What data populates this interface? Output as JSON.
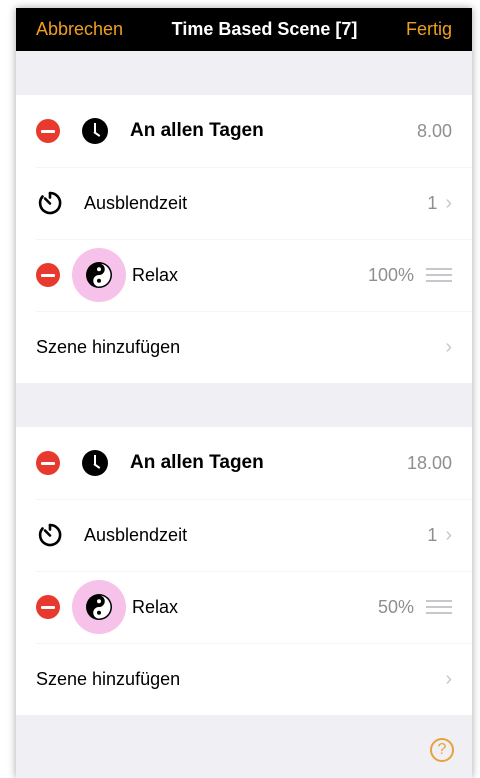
{
  "navbar": {
    "cancel_label": "Abbrechen",
    "title": "Time Based Scene [7]",
    "done_label": "Fertig"
  },
  "schedules": [
    {
      "time_title": "An allen Tagen",
      "time_value": "8.00",
      "fade_label": "Ausblendzeit",
      "fade_value": "1",
      "scene_name": "Relax",
      "scene_level": "100%",
      "add_label": "Szene hinzufügen"
    },
    {
      "time_title": "An allen Tagen",
      "time_value": "18.00",
      "fade_label": "Ausblendzeit",
      "fade_value": "1",
      "scene_name": "Relax",
      "scene_level": "50%",
      "add_label": "Szene hinzufügen"
    }
  ],
  "help": {
    "glyph": "?"
  },
  "colors": {
    "accent": "#f0a01e",
    "remove": "#e8392e",
    "scene_icon_bg": "#f6c2ea",
    "background": "#efeff4"
  },
  "icons": {
    "remove": "remove-icon",
    "clock": "clock-icon",
    "timer": "timer-icon",
    "yin_yang": "yin-yang-icon",
    "reorder": "reorder-handle-icon",
    "chevron": "chevron-right-icon",
    "help": "help-icon"
  }
}
